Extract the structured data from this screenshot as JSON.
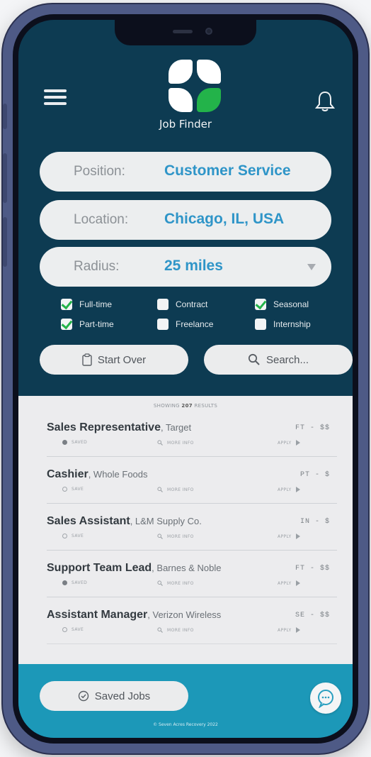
{
  "header": {
    "app_title": "Job Finder",
    "menu_icon": "hamburger-menu-icon",
    "notification_icon": "bell-icon"
  },
  "form": {
    "position": {
      "label": "Position:",
      "value": "Customer Service"
    },
    "location": {
      "label": "Location:",
      "value": "Chicago, IL, USA"
    },
    "radius": {
      "label": "Radius:",
      "value": "25 miles"
    }
  },
  "filters": {
    "full_time": {
      "label": "Full-time",
      "checked": true
    },
    "contract": {
      "label": "Contract",
      "checked": false
    },
    "seasonal": {
      "label": "Seasonal",
      "checked": true
    },
    "part_time": {
      "label": "Part-time",
      "checked": true
    },
    "freelance": {
      "label": "Freelance",
      "checked": false
    },
    "internship": {
      "label": "Internship",
      "checked": false
    }
  },
  "actions": {
    "start_over": "Start Over",
    "search": "Search..."
  },
  "results": {
    "showing_prefix": "SHOWING",
    "count": "207",
    "showing_suffix": "RESULTS",
    "items": [
      {
        "title": "Sales Representative",
        "company": ", Target",
        "tag": "FT - $$",
        "save": "SAVED",
        "saved": true,
        "info": "MORE INFO",
        "apply": "APPLY"
      },
      {
        "title": "Cashier",
        "company": ", Whole Foods",
        "tag": "PT - $",
        "save": "SAVE",
        "saved": false,
        "info": "MORE INFO",
        "apply": "APPLY"
      },
      {
        "title": "Sales Assistant",
        "company": ", L&M Supply Co.",
        "tag": "IN - $",
        "save": "SAVE",
        "saved": false,
        "info": "MORE INFO",
        "apply": "APPLY"
      },
      {
        "title": "Support Team Lead",
        "company": ", Barnes & Noble",
        "tag": "FT - $$",
        "save": "SAVED",
        "saved": true,
        "info": "MORE INFO",
        "apply": "APPLY"
      },
      {
        "title": "Assistant Manager",
        "company": ", Verizon Wireless",
        "tag": "SE - $$",
        "save": "SAVE",
        "saved": false,
        "info": "MORE INFO",
        "apply": "APPLY"
      }
    ]
  },
  "footer": {
    "saved_jobs": "Saved Jobs",
    "copyright": "© Seven Acres Recovery 2022"
  },
  "colors": {
    "header_bg": "#0d3b52",
    "footer_bg": "#1c98b8",
    "accent_value": "#2f95c8",
    "check_green": "#23b34a"
  }
}
